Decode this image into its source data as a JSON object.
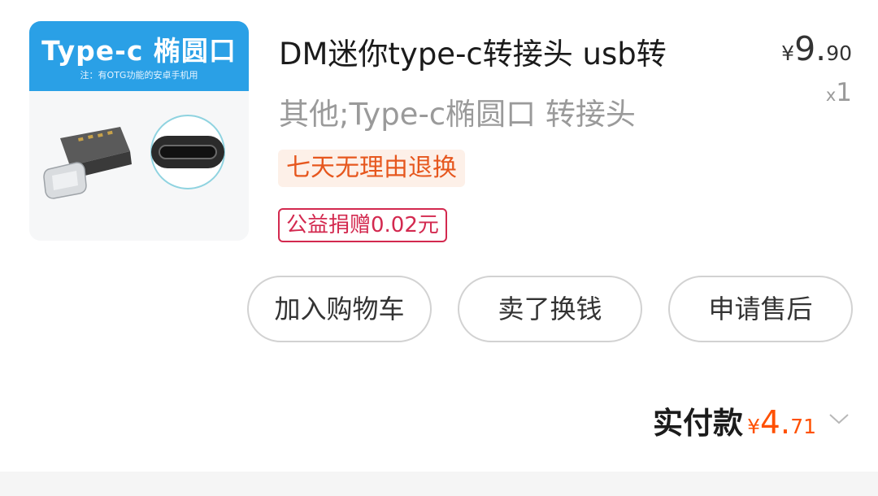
{
  "product": {
    "thumbnail": {
      "banner_title": "Type-c 椭圆口",
      "banner_note": "注：有OTG功能的安卓手机用",
      "banner_color": "#2aa0e6"
    },
    "title": "DM迷你type-c转接头 usb转",
    "spec": "其他;Type-c椭圆口 转接头",
    "price": {
      "currency": "¥",
      "integer": "9.",
      "decimal": "90"
    },
    "quantity": {
      "prefix": "x",
      "value": "1"
    },
    "tags": {
      "return_policy": "七天无理由退换",
      "charity": "公益捐赠0.02元"
    }
  },
  "actions": {
    "add_to_cart": "加入购物车",
    "resell": "卖了换钱",
    "after_sale": "申请售后"
  },
  "payment": {
    "label": "实付款",
    "currency": "¥",
    "integer": "4.",
    "decimal": "71",
    "accent_color": "#ff5000"
  }
}
